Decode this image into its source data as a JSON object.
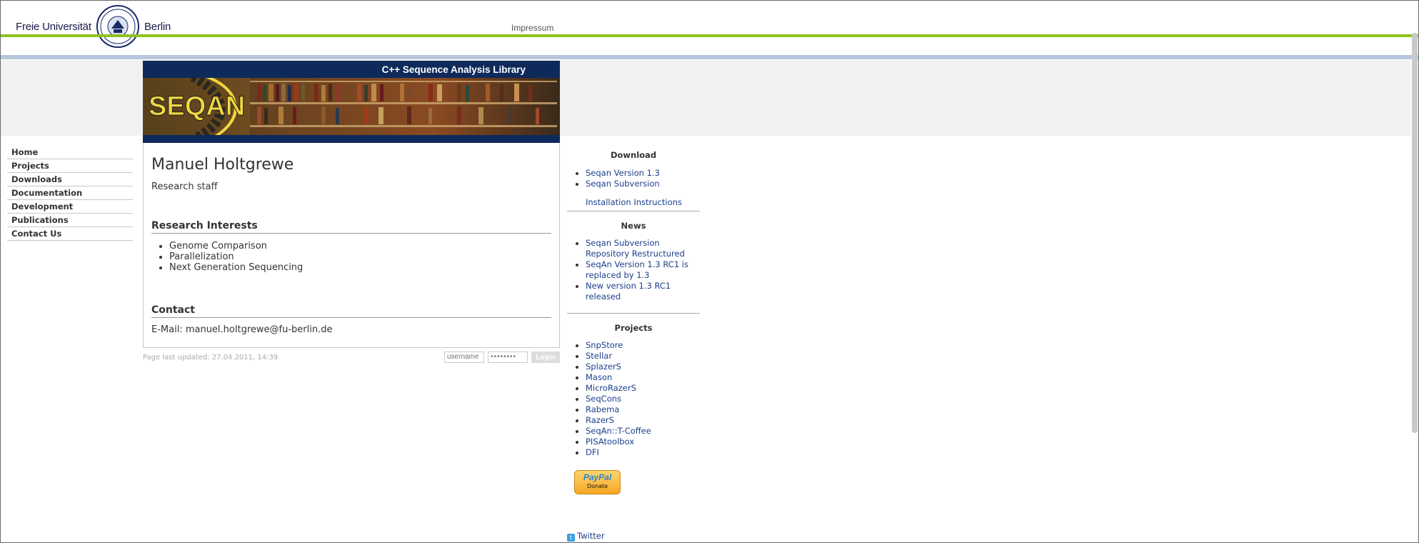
{
  "fu_header": {
    "logo_word_1": "Freie Universität",
    "logo_word_2": "Berlin",
    "impressum_label": "Impressum",
    "accent_green": "#8ec21f",
    "accent_blue": "#b7c6dc"
  },
  "banner": {
    "tagline": "C++ Sequence Analysis Library",
    "logo_text": "SEQAN",
    "background": "#0d2a5a"
  },
  "left_nav": {
    "items": [
      {
        "label": "Home"
      },
      {
        "label": "Projects"
      },
      {
        "label": "Downloads"
      },
      {
        "label": "Documentation"
      },
      {
        "label": "Development"
      },
      {
        "label": "Publications"
      },
      {
        "label": "Contact Us"
      }
    ]
  },
  "profile": {
    "name": "Manuel Holtgrewe",
    "role": "Research staff",
    "interests_heading": "Research Interests",
    "interests": [
      "Genome Comparison",
      "Parallelization",
      "Next Generation Sequencing"
    ],
    "contact_heading": "Contact",
    "email_line": "E-Mail: manuel.holtgrewe@fu-berlin.de"
  },
  "footer": {
    "last_updated": "Page last updated: 27.04.2011, 14:39",
    "username_placeholder": "username",
    "password_placeholder": "••••••••",
    "login_label": "Login"
  },
  "sidebar": {
    "download_heading": "Download",
    "download_links": [
      "Seqan Version 1.3",
      "Seqan Subversion"
    ],
    "install_link": "Installation Instructions",
    "news_heading": "News",
    "news_links": [
      "Seqan Subversion Repository Restructured",
      "SeqAn Version 1.3 RC1 is replaced by 1.3",
      "New version 1.3 RC1 released"
    ],
    "projects_heading": "Projects",
    "project_links": [
      "SnpStore",
      "Stellar",
      "SplazerS",
      "Mason",
      "MicroRazerS",
      "SeqCons",
      "Rabema",
      "RazerS",
      "SeqAn::T-Coffee",
      "PISAtoolbox",
      "DFI"
    ],
    "paypal_brand_1": "Pay",
    "paypal_brand_2": "Pal",
    "paypal_donate": "Donate",
    "twitter_label": "Twitter",
    "link_color": "#1c3f8c"
  }
}
